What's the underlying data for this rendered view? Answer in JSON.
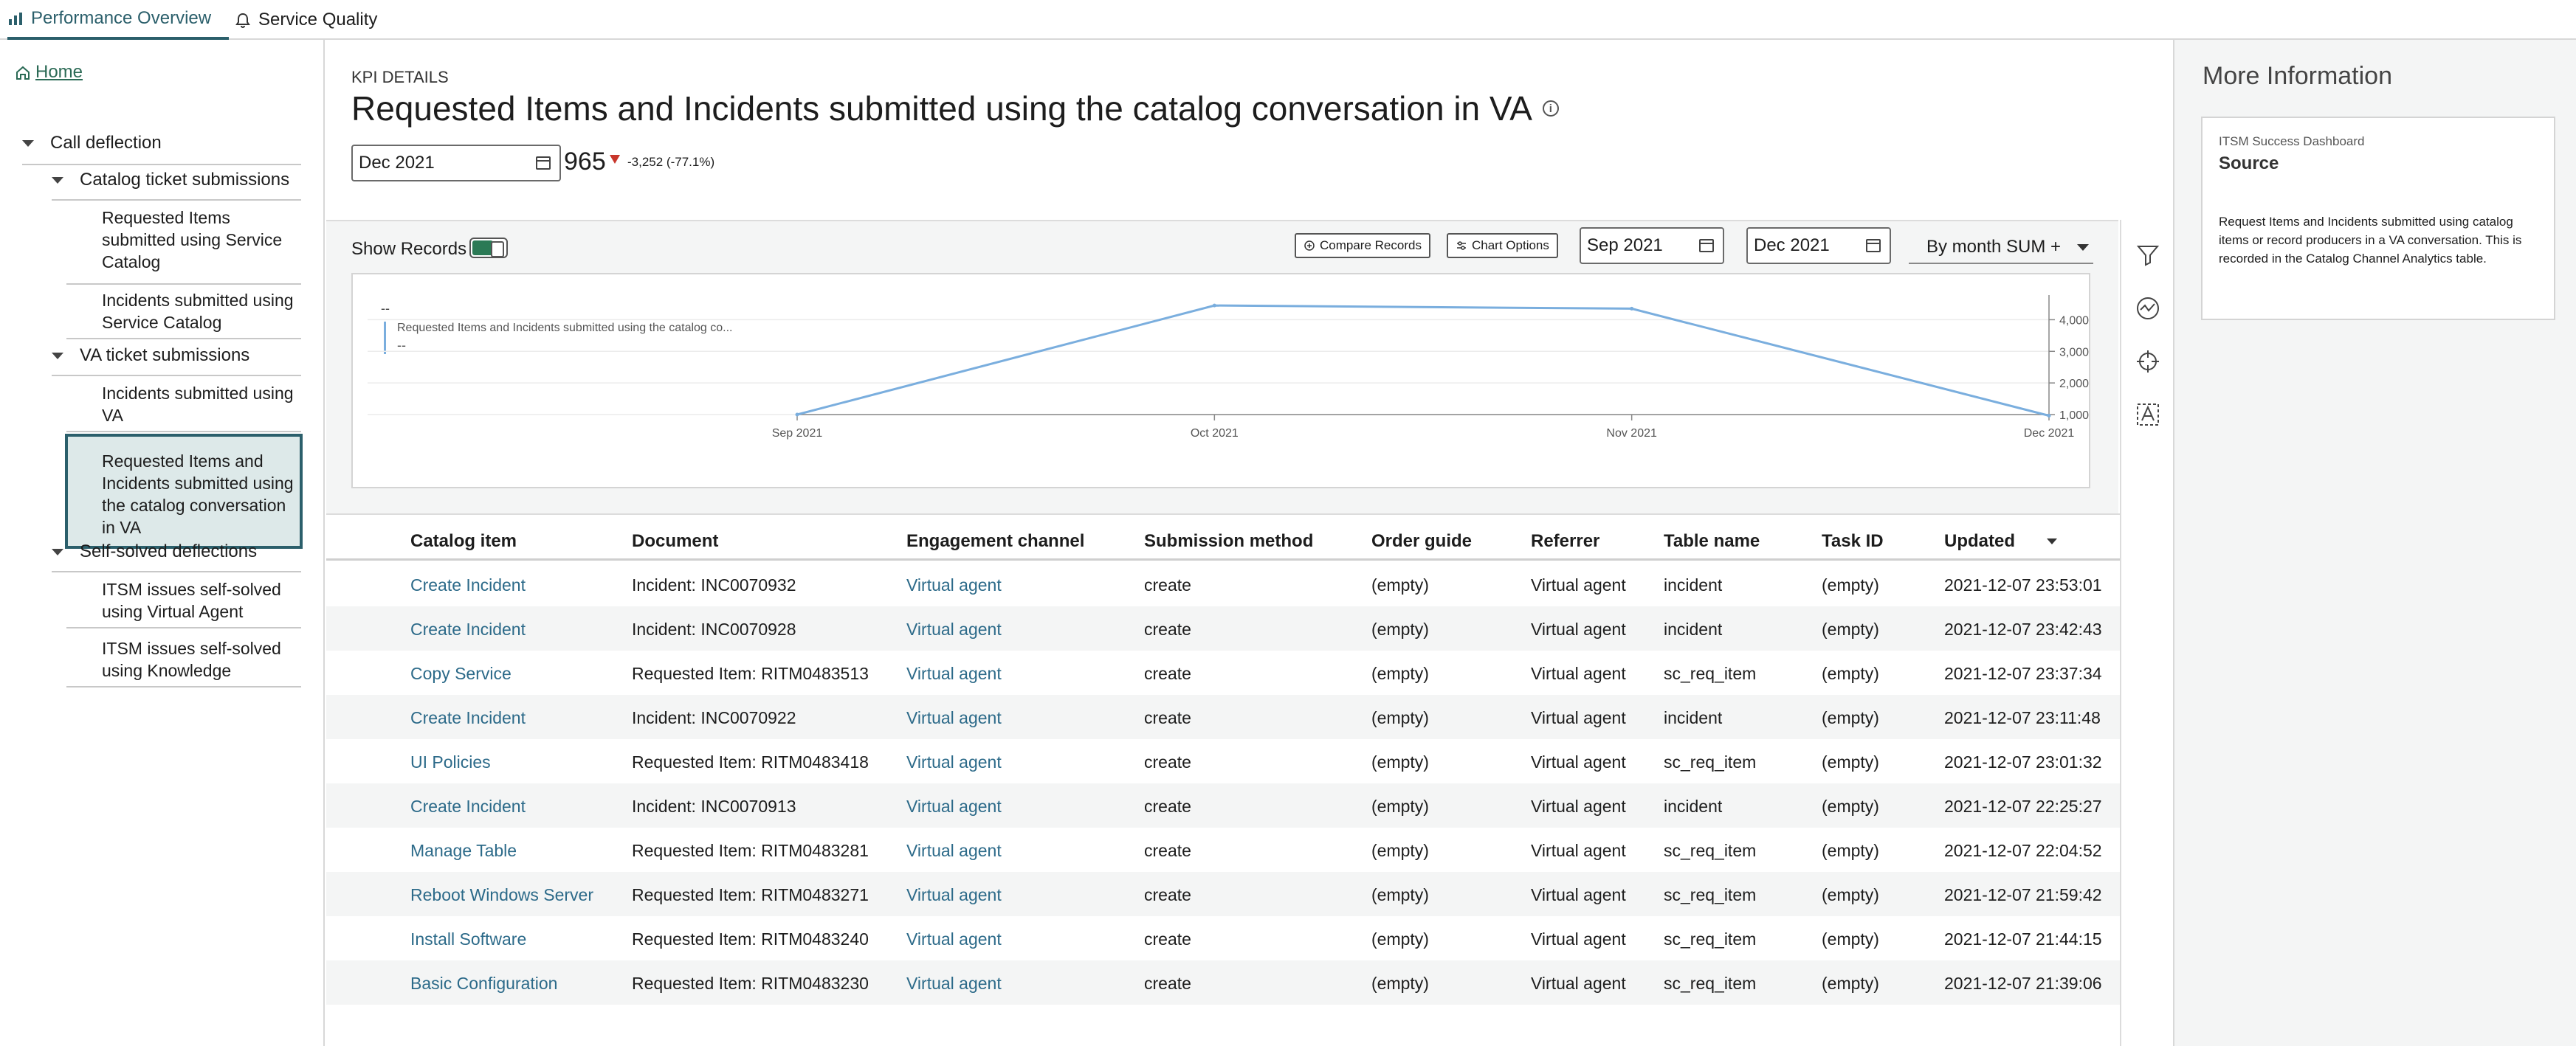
{
  "tabs": [
    {
      "label": "Performance Overview",
      "icon": "chart-icon",
      "active": true
    },
    {
      "label": "Service Quality",
      "icon": "bell-icon",
      "active": false
    }
  ],
  "nav": {
    "home": "Home",
    "call_deflection": "Call deflection",
    "catalog_ticket": "Catalog ticket submissions",
    "leaf_rq_catalog": "Requested Items submitted using Service Catalog",
    "leaf_inc_catalog": "Incidents submitted using Service Catalog",
    "va_ticket": "VA ticket submissions",
    "leaf_inc_va": "Incidents submitted using VA",
    "leaf_rq_va": "Requested Items and Incidents submitted using the catalog conversation in VA",
    "self_solved": "Self-solved deflections",
    "leaf_itsm_va": "ITSM issues self-solved using Virtual Agent",
    "leaf_itsm_kb": "ITSM issues self-solved using Knowledge"
  },
  "header": {
    "kpi_label": "KPI DETAILS",
    "title": "Requested Items and Incidents submitted using the catalog conversation in VA",
    "date": "Dec 2021",
    "value": "965",
    "change": "-3,252 (-77.1%)"
  },
  "controls": {
    "show_records": "Show Records",
    "compare": "Compare Records",
    "chart_options": "Chart Options",
    "from": "Sep 2021",
    "to": "Dec 2021",
    "aggregation": "By month SUM +"
  },
  "legend": {
    "dash": "--",
    "name": "Requested Items and Incidents submitted using the catalog co...",
    "value": "--"
  },
  "chart_data": {
    "type": "line",
    "categories": [
      "Sep 2021",
      "Oct 2021",
      "Nov 2021",
      "Dec 2021"
    ],
    "values": [
      1000,
      4450,
      4350,
      965
    ],
    "y_ticks": [
      "1,000",
      "2,000",
      "3,000",
      "4,000"
    ],
    "ylim": [
      1000,
      4500
    ],
    "line_color": "#7aaede",
    "grid": true
  },
  "table": {
    "columns": [
      "Catalog item",
      "Document",
      "Engagement channel",
      "Submission method",
      "Order guide",
      "Referrer",
      "Table name",
      "Task ID",
      "Updated"
    ],
    "rows": [
      [
        "Create Incident",
        "Incident: INC0070932",
        "Virtual agent",
        "create",
        "(empty)",
        "Virtual agent",
        "incident",
        "(empty)",
        "2021-12-07 23:53:01"
      ],
      [
        "Create Incident",
        "Incident: INC0070928",
        "Virtual agent",
        "create",
        "(empty)",
        "Virtual agent",
        "incident",
        "(empty)",
        "2021-12-07 23:42:43"
      ],
      [
        "Copy Service",
        "Requested Item: RITM0483513",
        "Virtual agent",
        "create",
        "(empty)",
        "Virtual agent",
        "sc_req_item",
        "(empty)",
        "2021-12-07 23:37:34"
      ],
      [
        "Create Incident",
        "Incident: INC0070922",
        "Virtual agent",
        "create",
        "(empty)",
        "Virtual agent",
        "incident",
        "(empty)",
        "2021-12-07 23:11:48"
      ],
      [
        "UI Policies",
        "Requested Item: RITM0483418",
        "Virtual agent",
        "create",
        "(empty)",
        "Virtual agent",
        "sc_req_item",
        "(empty)",
        "2021-12-07 23:01:32"
      ],
      [
        "Create Incident",
        "Incident: INC0070913",
        "Virtual agent",
        "create",
        "(empty)",
        "Virtual agent",
        "incident",
        "(empty)",
        "2021-12-07 22:25:27"
      ],
      [
        "Manage Table",
        "Requested Item: RITM0483281",
        "Virtual agent",
        "create",
        "(empty)",
        "Virtual agent",
        "sc_req_item",
        "(empty)",
        "2021-12-07 22:04:52"
      ],
      [
        "Reboot Windows Server",
        "Requested Item: RITM0483271",
        "Virtual agent",
        "create",
        "(empty)",
        "Virtual agent",
        "sc_req_item",
        "(empty)",
        "2021-12-07 21:59:42"
      ],
      [
        "Install Software",
        "Requested Item: RITM0483240",
        "Virtual agent",
        "create",
        "(empty)",
        "Virtual agent",
        "sc_req_item",
        "(empty)",
        "2021-12-07 21:44:15"
      ],
      [
        "Basic Configuration",
        "Requested Item: RITM0483230",
        "Virtual agent",
        "create",
        "(empty)",
        "Virtual agent",
        "sc_req_item",
        "(empty)",
        "2021-12-07 21:39:06"
      ]
    ]
  },
  "right_panel": {
    "title": "More Information",
    "dashboard": "ITSM Success Dashboard",
    "source_label": "Source",
    "description": "Request Items and Incidents submitted using catalog items or record producers in a VA conversation. This is recorded in the Catalog Channel Analytics table."
  }
}
